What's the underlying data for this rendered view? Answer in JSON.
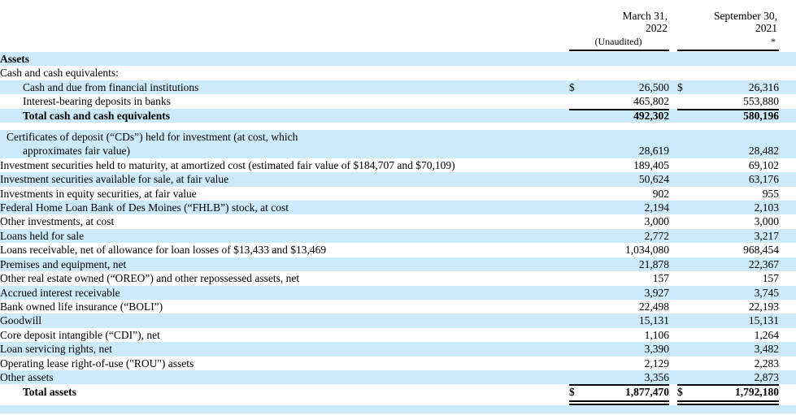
{
  "document": {
    "type": "balance-sheet",
    "section_title": "Assets",
    "shade_color": "#cdeafb"
  },
  "header": {
    "col1_line1": "March 31,",
    "col1_line2": "2022",
    "col1_sub": "(Unaudited)",
    "col2_line1": "September 30,",
    "col2_line2": "2021",
    "col2_sub": "*"
  },
  "currency_symbol": "$",
  "rows": [
    {
      "label": "Assets",
      "bold": true,
      "indent": 0,
      "shaded": true,
      "v1": "",
      "v2": "",
      "cur1": "",
      "cur2": ""
    },
    {
      "label": "Cash and cash equivalents:",
      "bold": false,
      "indent": 0,
      "shaded": false,
      "v1": "",
      "v2": "",
      "cur1": "",
      "cur2": ""
    },
    {
      "label": "Cash and due from financial institutions",
      "bold": false,
      "indent": 1,
      "shaded": true,
      "v1": "26,500",
      "v2": "26,316",
      "cur1": "$",
      "cur2": "$"
    },
    {
      "label": "Interest-bearing deposits in banks",
      "bold": false,
      "indent": 1,
      "shaded": false,
      "v1": "465,802",
      "v2": "553,880",
      "cur1": "",
      "cur2": ""
    },
    {
      "label": "Total cash and cash equivalents",
      "bold": true,
      "indent": 1,
      "shaded": true,
      "v1": "492,302",
      "v2": "580,196",
      "cur1": "",
      "cur2": "",
      "rule_above": true
    },
    {
      "label": "Certificates of deposit (“CDs”) held for investment (at cost, which",
      "label2": "approximates fair value)",
      "bold": false,
      "indent": 0,
      "shaded": true,
      "v1": "28,619",
      "v2": "28,482",
      "cur1": "",
      "cur2": "",
      "two_line": true,
      "spacer_before": true
    },
    {
      "label": "Investment securities held to maturity, at amortized cost (estimated fair value of $184,707 and $70,109)",
      "bold": false,
      "indent": 0,
      "shaded": false,
      "v1": "189,405",
      "v2": "69,102",
      "cur1": "",
      "cur2": ""
    },
    {
      "label": "Investment securities available for sale, at fair value",
      "bold": false,
      "indent": 0,
      "shaded": true,
      "v1": "50,624",
      "v2": "63,176",
      "cur1": "",
      "cur2": ""
    },
    {
      "label": "Investments in equity securities, at fair value",
      "bold": false,
      "indent": 0,
      "shaded": false,
      "v1": "902",
      "v2": "955",
      "cur1": "",
      "cur2": ""
    },
    {
      "label": "Federal Home Loan Bank of Des Moines (“FHLB”) stock, at cost",
      "bold": false,
      "indent": 0,
      "shaded": true,
      "v1": "2,194",
      "v2": "2,103",
      "cur1": "",
      "cur2": ""
    },
    {
      "label": "Other investments, at cost",
      "bold": false,
      "indent": 0,
      "shaded": false,
      "v1": "3,000",
      "v2": "3,000",
      "cur1": "",
      "cur2": ""
    },
    {
      "label": "Loans held for sale",
      "bold": false,
      "indent": 0,
      "shaded": true,
      "v1": "2,772",
      "v2": "3,217",
      "cur1": "",
      "cur2": ""
    },
    {
      "label": "Loans receivable, net of allowance for loan losses of $13,433 and $13,469",
      "bold": false,
      "indent": 0,
      "shaded": false,
      "v1": "1,034,080",
      "v2": "968,454",
      "cur1": "",
      "cur2": ""
    },
    {
      "label": "Premises and equipment, net",
      "bold": false,
      "indent": 0,
      "shaded": true,
      "v1": "21,878",
      "v2": "22,367",
      "cur1": "",
      "cur2": ""
    },
    {
      "label": "Other real estate owned (“OREO”) and other repossessed assets, net",
      "bold": false,
      "indent": 0,
      "shaded": false,
      "v1": "157",
      "v2": "157",
      "cur1": "",
      "cur2": ""
    },
    {
      "label": "Accrued interest receivable",
      "bold": false,
      "indent": 0,
      "shaded": true,
      "v1": "3,927",
      "v2": "3,745",
      "cur1": "",
      "cur2": ""
    },
    {
      "label": "Bank owned life insurance (“BOLI”)",
      "bold": false,
      "indent": 0,
      "shaded": false,
      "v1": "22,498",
      "v2": "22,193",
      "cur1": "",
      "cur2": ""
    },
    {
      "label": "Goodwill",
      "bold": false,
      "indent": 0,
      "shaded": true,
      "v1": "15,131",
      "v2": "15,131",
      "cur1": "",
      "cur2": ""
    },
    {
      "label": "Core deposit intangible (“CDI”), net",
      "bold": false,
      "indent": 0,
      "shaded": false,
      "v1": "1,106",
      "v2": "1,264",
      "cur1": "",
      "cur2": ""
    },
    {
      "label": "Loan servicing rights, net",
      "bold": false,
      "indent": 0,
      "shaded": true,
      "v1": "3,390",
      "v2": "3,482",
      "cur1": "",
      "cur2": ""
    },
    {
      "label": "Operating lease right-of-use (\"ROU\") assets",
      "bold": false,
      "indent": 0,
      "shaded": false,
      "v1": "2,129",
      "v2": "2,283",
      "cur1": "",
      "cur2": ""
    },
    {
      "label": "Other assets",
      "bold": false,
      "indent": 0,
      "shaded": true,
      "v1": "3,356",
      "v2": "2,873",
      "cur1": "",
      "cur2": ""
    },
    {
      "label": "Total assets",
      "bold": true,
      "indent": 1,
      "shaded": false,
      "v1": "1,877,470",
      "v2": "1,792,180",
      "cur1": "$",
      "cur2": "$",
      "grand_total": true
    }
  ]
}
